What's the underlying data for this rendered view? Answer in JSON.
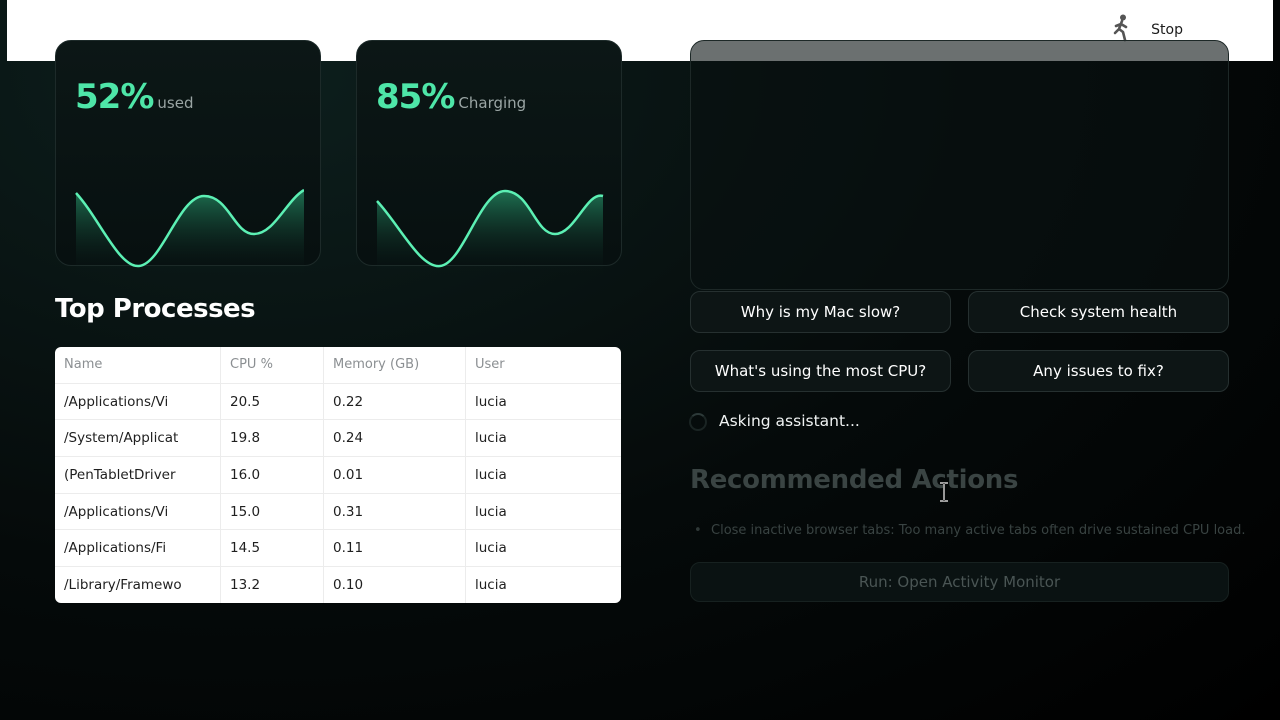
{
  "topbar": {
    "stop_label": "Stop",
    "icon": "walking-figure-icon"
  },
  "cards": [
    {
      "value": "52%",
      "caption": "used",
      "accent": "#4ee6a8"
    },
    {
      "value": "85%",
      "caption": "Charging",
      "accent": "#4ee6a8"
    }
  ],
  "processes": {
    "title": "Top Processes",
    "columns": [
      "Name",
      "CPU %",
      "Memory (GB)",
      "User"
    ],
    "rows": [
      [
        "/Applications/Vi",
        "20.5",
        "0.22",
        "lucia"
      ],
      [
        "/System/Applicat",
        "19.8",
        "0.24",
        "lucia"
      ],
      [
        "(PenTabletDriver",
        "16.0",
        "0.01",
        "lucia"
      ],
      [
        "/Applications/Vi",
        "15.0",
        "0.31",
        "lucia"
      ],
      [
        "/Applications/Fi",
        "14.5",
        "0.11",
        "lucia"
      ],
      [
        "/Library/Framewo",
        "13.2",
        "0.10",
        "lucia"
      ]
    ]
  },
  "assistant": {
    "questions": [
      "Why is my Mac slow?",
      "Check system health",
      "What's using the most CPU?",
      "Any issues to fix?"
    ],
    "status": "Asking assistant..."
  },
  "recommended": {
    "title": "Recommended Actions",
    "items": [
      "Close inactive browser tabs: Too many active tabs often drive sustained CPU load."
    ],
    "run_button": "Run: Open Activity Monitor"
  }
}
